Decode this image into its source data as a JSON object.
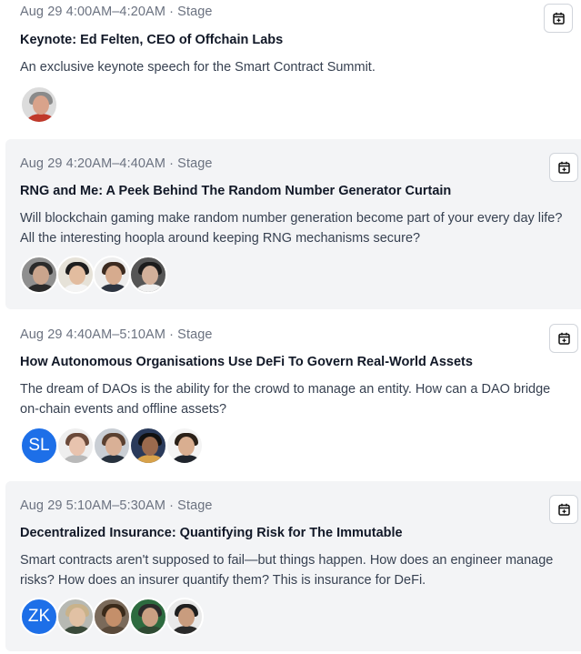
{
  "sessions": [
    {
      "time": "Aug 29 4:00AM–4:20AM · Stage",
      "title": "Keynote: Ed Felten, CEO of Offchain Labs",
      "description": "An exclusive keynote speech for the Smart Contract Summit.",
      "speakers": [
        {
          "bg": "#dcdcdc",
          "hair": "#8a8a8a",
          "face": "#d9a38b",
          "body": "#c0392b"
        }
      ]
    },
    {
      "time": "Aug 29 4:20AM–4:40AM · Stage",
      "title": "RNG and Me: A Peek Behind The Random Number Generator Curtain",
      "description": "Will blockchain gaming make random number generation become part of your every day life? All the interesting hoopla around keeping RNG mechanisms secure?",
      "speakers": [
        {
          "bg": "#8f8f8f",
          "hair": "#2b2b2b",
          "face": "#caa58d",
          "body": "#2a2a2a"
        },
        {
          "bg": "#e6e2d8",
          "hair": "#1e1e1e",
          "face": "#e2bc9f",
          "body": "#f4f4f4"
        },
        {
          "bg": "#ededed",
          "hair": "#3b2a20",
          "face": "#d6ab8e",
          "body": "#2d3440"
        },
        {
          "bg": "#555555",
          "hair": "#1c1c1c",
          "face": "#d2b09a",
          "body": "#f0f0f0"
        }
      ]
    },
    {
      "time": "Aug 29 4:40AM–5:10AM · Stage",
      "title": "How Autonomous Organisations Use DeFi To Govern Real-World Assets",
      "description": "The dream of DAOs is the ability for the crowd to manage an entity. How can a DAO bridge on-chain events and offline assets?",
      "initials": "SL",
      "speakers": [
        {
          "bg": "#eeeeee",
          "hair": "#6b4a3a",
          "face": "#e8c3ae",
          "body": "#b9b9b9"
        },
        {
          "bg": "#c9ced4",
          "hair": "#5a4030",
          "face": "#d9b096",
          "body": "#27313d"
        },
        {
          "bg": "#2a3a5a",
          "hair": "#111111",
          "face": "#9b6a4d",
          "body": "#d8a24a"
        },
        {
          "bg": "#f4f4f4",
          "hair": "#2b2118",
          "face": "#d9ae90",
          "body": "#1f242c"
        }
      ]
    },
    {
      "time": "Aug 29 5:10AM–5:30AM · Stage",
      "title": "Decentralized Insurance: Quantifying Risk for The Immutable",
      "description": "Smart contracts aren't supposed to fail—but things happen. How does an engineer manage risks? How does an insurer quantify them? This is insurance for DeFi.",
      "initials": "ZK",
      "speakers": [
        {
          "bg": "#b7b9b3",
          "hair": "#c9b28a",
          "face": "#e1c1a4",
          "body": "#3a4a3a"
        },
        {
          "bg": "#7a6a5a",
          "hair": "#3a2a1a",
          "face": "#c48f6a",
          "body": "#5a4a3a"
        },
        {
          "bg": "#2d6b3f",
          "hair": "#2b2b2b",
          "face": "#caa083",
          "body": "#2f4a33"
        },
        {
          "bg": "#e9e9e9",
          "hair": "#1f1f1f",
          "face": "#c99c7e",
          "body": "#2a2a2a"
        }
      ]
    }
  ],
  "icons": {
    "calendar": "calendar-add-icon"
  },
  "colors": {
    "initials_bg": "#1d6fe8",
    "shaded_bg": "#f3f4f6"
  }
}
